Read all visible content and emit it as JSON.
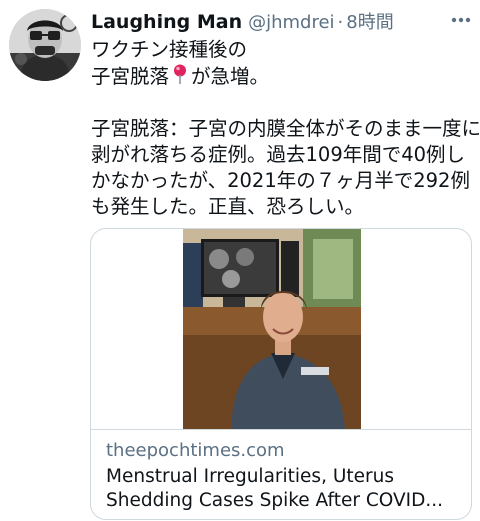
{
  "tweet": {
    "author_name": "Laughing Man",
    "handle": "@jhmdrei",
    "separator": "·",
    "time": "8時間",
    "text_lines": [
      "ワクチン接種後の",
      "子宮脱落",
      "が急増。",
      "子宮脱落：子宮の内膜全体がそのまま一度に",
      "剥がれ落ちる症例。過去109年間で40例し",
      "かなかったが、2021年の７ヶ月半で292例",
      "も発生した。正直、恐ろしい。"
    ],
    "pin_emoji": "📍"
  },
  "card": {
    "domain": "theepochtimes.com",
    "title": "Menstrual Irregularities, Uterus Shedding Cases Spike After COVID..."
  },
  "icons": {
    "more": "more-icon",
    "pin": "round-pushpin-icon",
    "avatar": "laughing-man-logo"
  },
  "colors": {
    "text": "#0f1419",
    "secondary": "#5b7083",
    "border": "#cfd9de",
    "pin_red": "#e0245e"
  }
}
